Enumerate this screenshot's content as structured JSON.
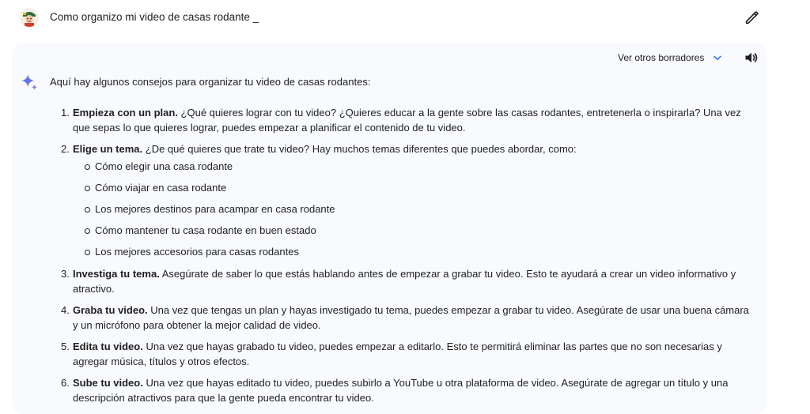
{
  "prompt": {
    "text": "Como organizo mi video de casas rodante  _"
  },
  "toolbar": {
    "drafts_label": "Ver otros borradores"
  },
  "icons": {
    "avatar": "user-avatar",
    "edit": "pencil-icon",
    "chevron": "chevron-down-icon",
    "speaker": "speaker-icon",
    "sparkle": "gemini-sparkle-icon"
  },
  "colors": {
    "card_bg": "#f8fafd",
    "accent": "#1a73e8",
    "text": "#1f1f1f"
  },
  "response": {
    "intro": "Aquí hay algunos consejos para organizar tu video de casas rodantes:",
    "items": [
      {
        "num": "1.",
        "title": "Empieza con un plan.",
        "line1": " ¿Qué quieres lograr con tu video? ¿Quieres educar a la gente sobre las casas rodantes, entretenerla o inspirarla? Una vez",
        "line2": "que sepas lo que quieres lograr, puedes empezar a planificar el contenido de tu video."
      },
      {
        "num": "2.",
        "title": "Elige un tema.",
        "line1": " ¿De qué quieres que trate tu video? Hay muchos temas diferentes que puedes abordar, como:",
        "bullets": [
          "Cómo elegir una casa rodante",
          "Cómo viajar en casa rodante",
          "Los mejores destinos para acampar en casa rodante",
          "Cómo mantener tu casa rodante en buen estado",
          "Los mejores accesorios para casas rodantes"
        ]
      },
      {
        "num": "3.",
        "title": "Investiga tu tema.",
        "line1": " Asegúrate de saber lo que estás hablando antes de empezar a grabar tu video. Esto te ayudará a crear un video informativo y",
        "line2": "atractivo."
      },
      {
        "num": "4.",
        "title": "Graba tu video.",
        "line1": " Una vez que tengas un plan y hayas investigado tu tema, puedes empezar a grabar tu video. Asegúrate de usar una buena cámara",
        "line2": "y un micrófono para obtener la mejor calidad de video."
      },
      {
        "num": "5.",
        "title": "Edita tu video.",
        "line1": " Una vez que hayas grabado tu video, puedes empezar a editarlo. Esto te permitirá eliminar las partes que no son necesarias y",
        "line2": "agregar música, títulos y otros efectos."
      },
      {
        "num": "6.",
        "title": "Sube tu video.",
        "line1": " Una vez que hayas editado tu video, puedes subirlo a YouTube u otra plataforma de video. Asegúrate de agregar un título y una",
        "line2": "descripción atractivos para que la gente pueda encontrar tu video."
      }
    ]
  }
}
